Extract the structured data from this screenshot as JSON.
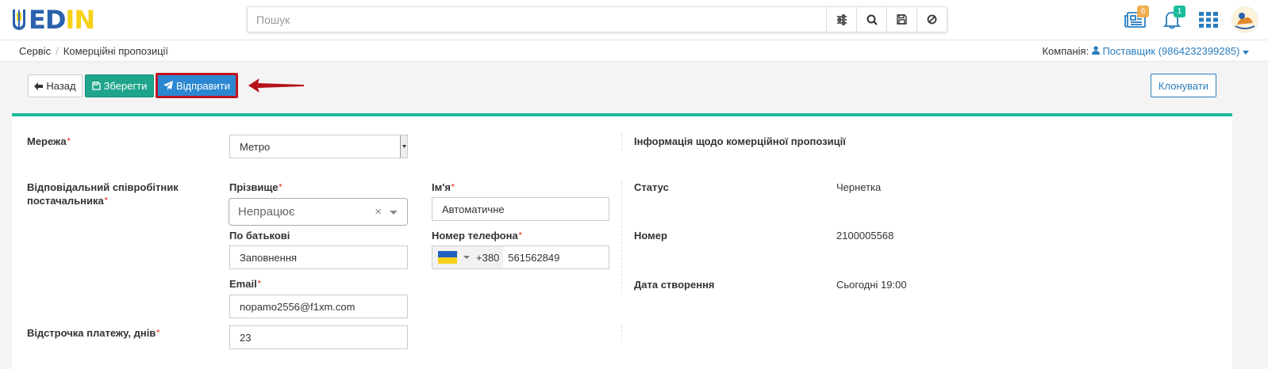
{
  "header": {
    "logo_text": "EDIN",
    "search_placeholder": "Пошук",
    "badges": {
      "news": "6",
      "notifications": "1"
    }
  },
  "breadcrumb": {
    "items": [
      "Сервіс",
      "Комерційні пропозиції"
    ]
  },
  "company": {
    "label": "Компанія:",
    "value": "Поставщик (9864232399285)"
  },
  "toolbar": {
    "back_label": "Назад",
    "save_label": "Зберегти",
    "send_label": "Відправити",
    "clone_label": "Клонувати"
  },
  "form": {
    "network_label": "Мережа",
    "network_value": "Метро",
    "responsible_label": "Відповідальний співробітник постачальника",
    "surname_label": "Прізвище",
    "surname_value": "Непрацює",
    "name_label": "Ім'я",
    "name_value": "Автоматичне",
    "patronymic_label": "По батькові",
    "patronymic_value": "Заповнення",
    "phone_label": "Номер телефона",
    "phone_code": "+380",
    "phone_value": "561562849",
    "email_label": "Email",
    "email_value": "nopamo2556@f1xm.com",
    "deferral_label": "Відстрочка платежу, днів",
    "deferral_value": "23"
  },
  "info": {
    "heading": "Інформація щодо комерційної пропозиції",
    "status_label": "Статус",
    "status_value": "Чернетка",
    "number_label": "Номер",
    "number_value": "2100005568",
    "created_label": "Дата створення",
    "created_value": "Сьогодні 19:00"
  },
  "colors": {
    "accent_green": "#1abc9c",
    "send_blue": "#2b87d1",
    "annotation_red": "#c1121f",
    "link_blue": "#2b7dbd"
  }
}
